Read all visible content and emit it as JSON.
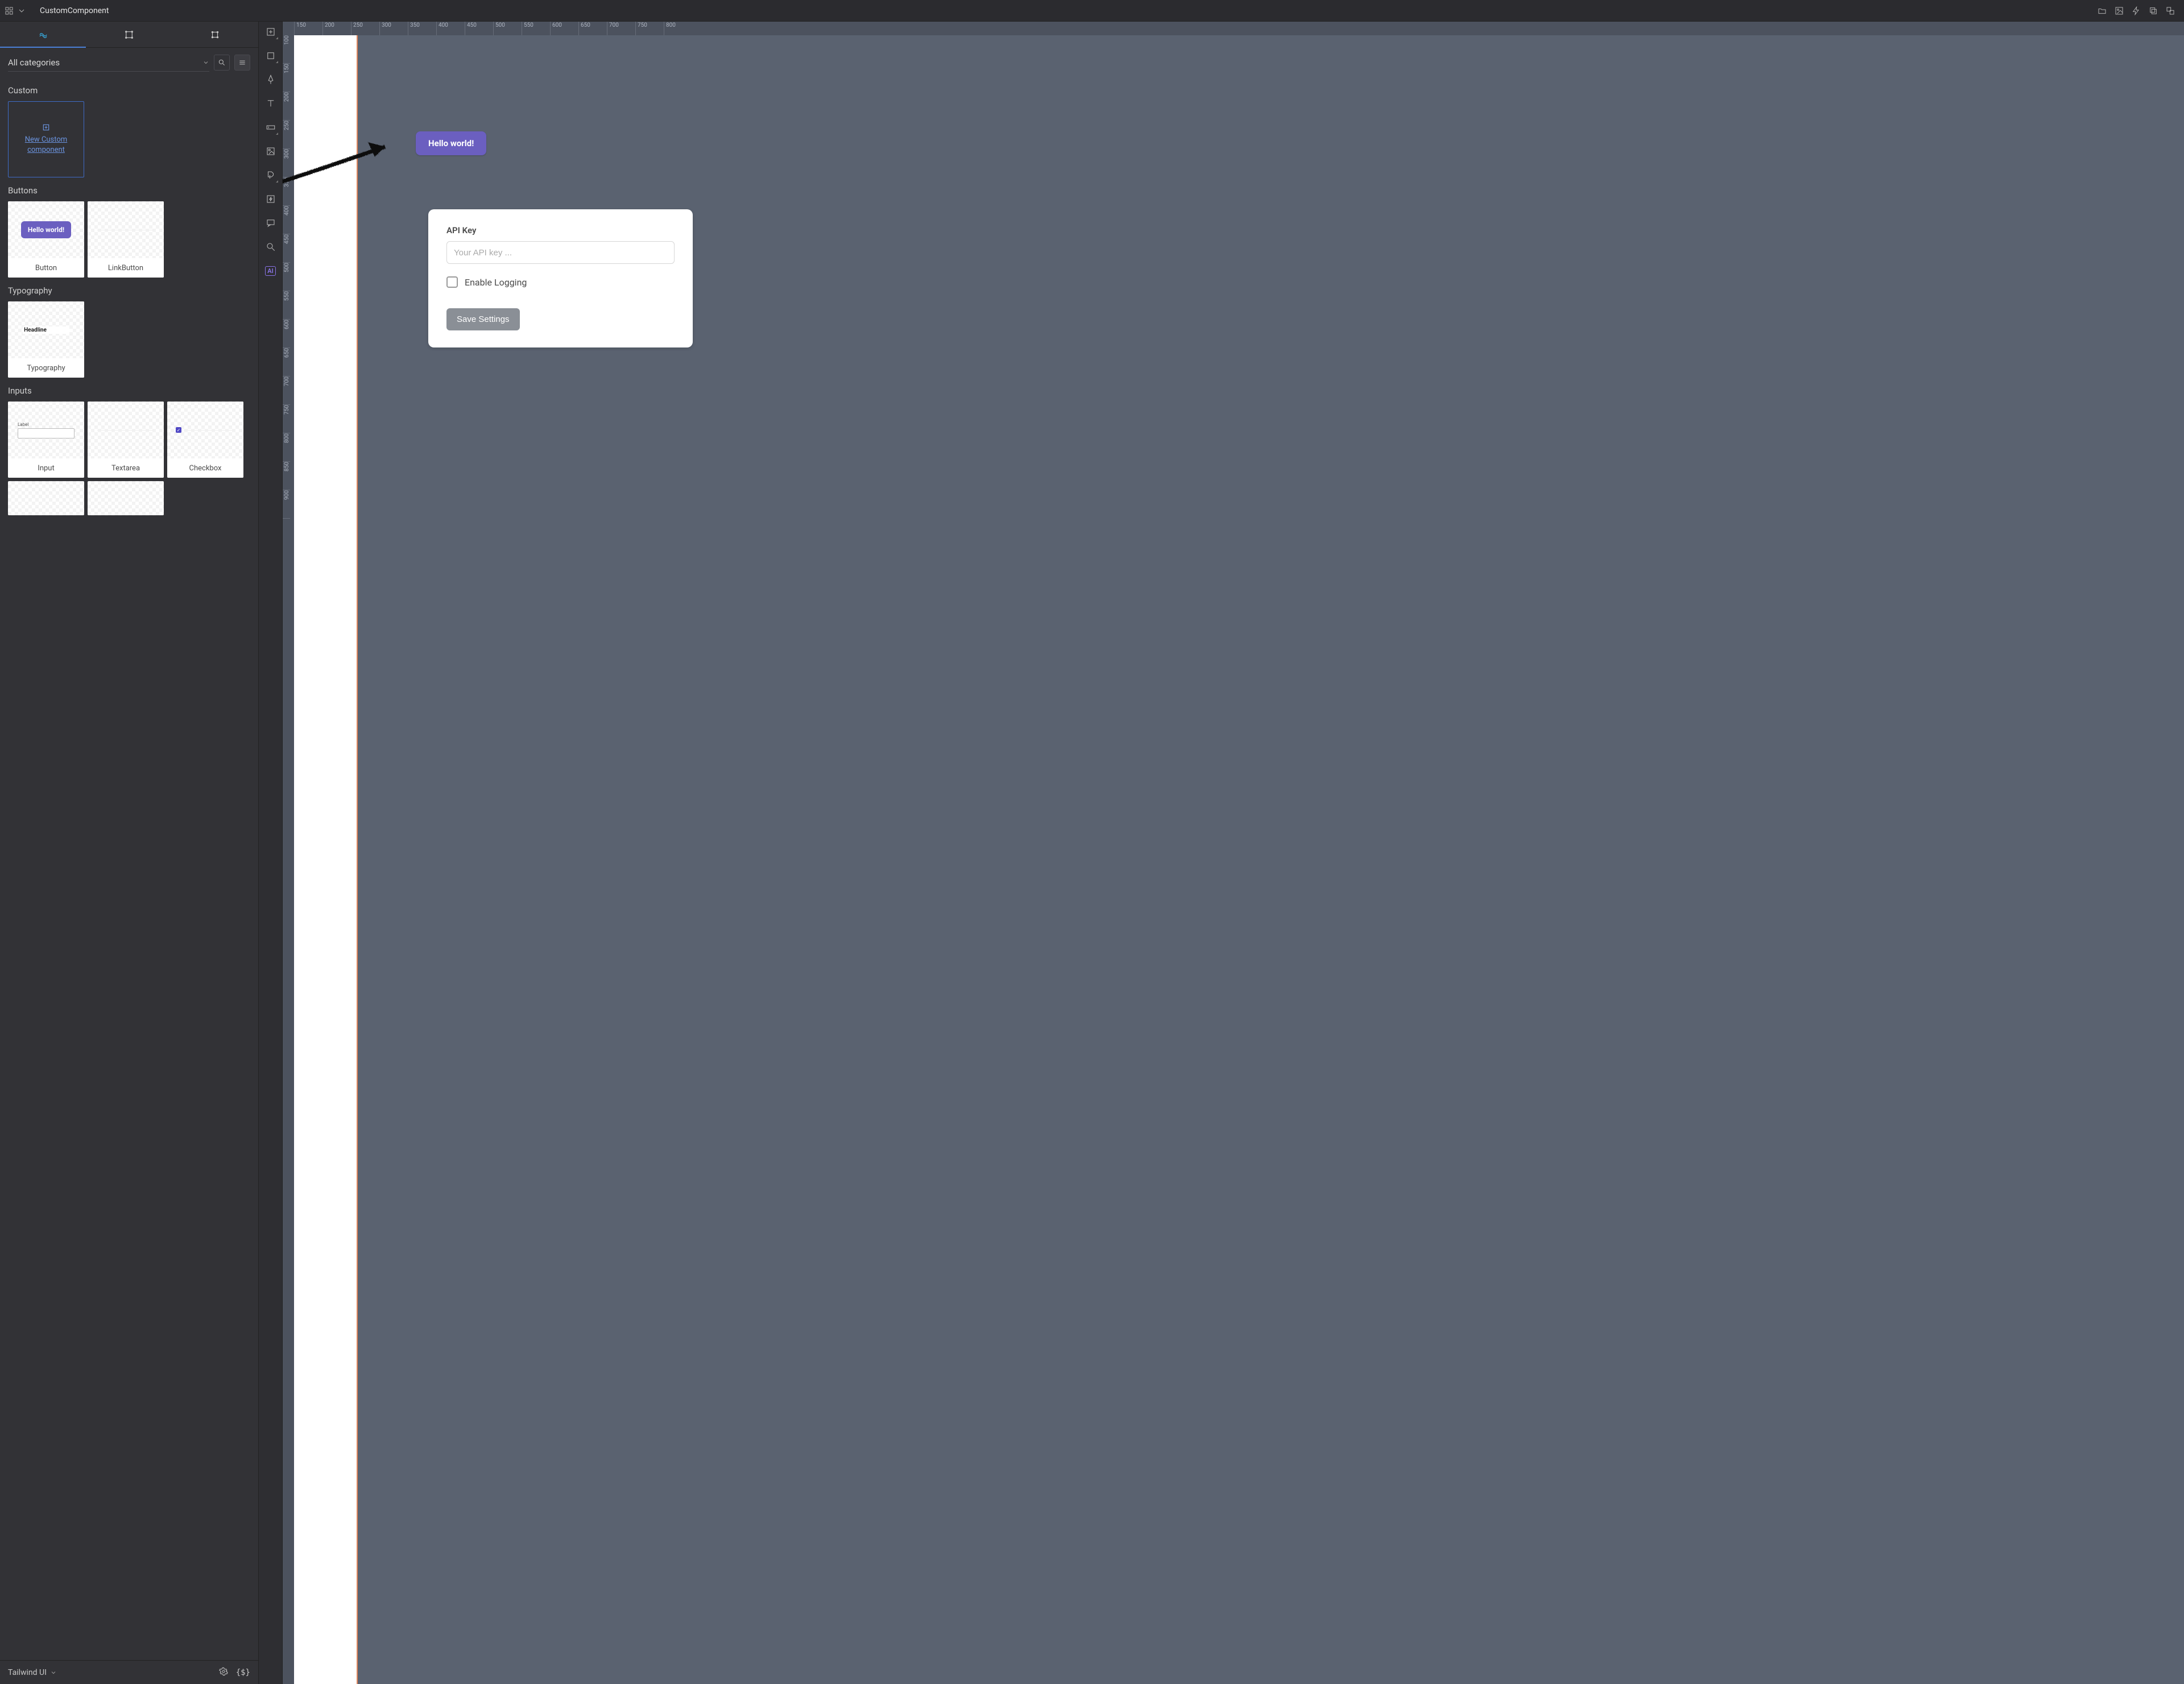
{
  "header": {
    "title": "CustomComponent"
  },
  "panel": {
    "category_label": "All categories",
    "sections": {
      "custom": {
        "title": "Custom",
        "new_label": "New Custom component"
      },
      "buttons": {
        "title": "Buttons",
        "items": [
          {
            "label": "Button",
            "preview_text": "Hello world!"
          },
          {
            "label": "LinkButton"
          }
        ]
      },
      "typography": {
        "title": "Typography",
        "items": [
          {
            "label": "Typography",
            "preview_text": "Headline"
          }
        ]
      },
      "inputs": {
        "title": "Inputs",
        "items": [
          {
            "label": "Input",
            "preview_text": "Label"
          },
          {
            "label": "Textarea"
          },
          {
            "label": "Checkbox"
          }
        ]
      }
    },
    "footer_library": "Tailwind UI"
  },
  "canvas": {
    "ruler_h": [
      "150",
      "200",
      "250",
      "300",
      "350",
      "400",
      "450",
      "500",
      "550",
      "600",
      "650",
      "700",
      "750",
      "800"
    ],
    "ruler_v": [
      "100",
      "150",
      "200",
      "250",
      "300",
      "350",
      "400",
      "450",
      "500",
      "550",
      "600",
      "650",
      "700",
      "750",
      "800",
      "850",
      "900"
    ],
    "hello_button": "Hello world!",
    "settings": {
      "api_label": "API Key",
      "api_placeholder": "Your API key ...",
      "logging_label": "Enable Logging",
      "save_label": "Save Settings"
    }
  }
}
